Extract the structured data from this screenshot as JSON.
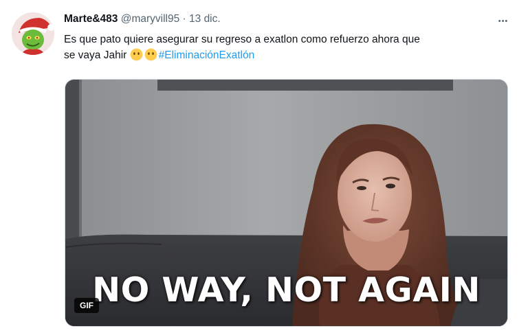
{
  "tweet": {
    "author_name": "Marte&483",
    "author_handle": "@maryvill95",
    "separator": "·",
    "timestamp": "13 dic.",
    "more_label": "•••",
    "text_line1": "Es que pato quiere asegurar su regreso a exatlon como refuerzo ahora que",
    "text_line2_prefix": "se vaya Jahir",
    "emoji": [
      "face-without-mouth-emoji",
      "face-without-mouth-emoji"
    ],
    "hashtag": "#EliminaciónExatlón"
  },
  "media": {
    "type": "gif",
    "caption": "NO WAY, NOT AGAIN",
    "badge": "GIF"
  },
  "colors": {
    "accent": "#1d9bf0",
    "secondary_text": "#536471",
    "primary_text": "#0f1419"
  }
}
